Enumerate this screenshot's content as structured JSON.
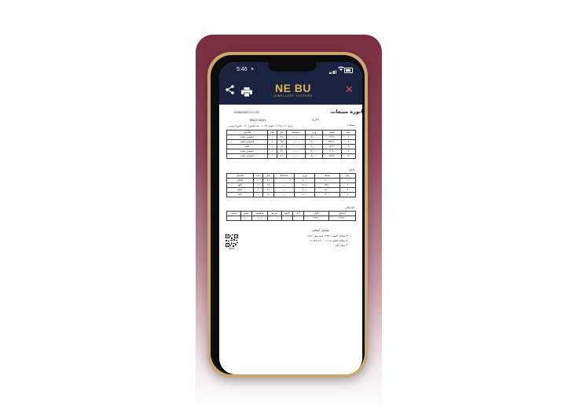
{
  "status_bar": {
    "time": "5:46",
    "location_glyph": "➤"
  },
  "app_bar": {
    "logo": "NE BU",
    "logo_subtitle": "JEWELLERY SYSTEMS",
    "share_icon": "share-icon",
    "print_icon": "printer-icon",
    "close_icon": "close-icon",
    "close_color": "#e04b4b",
    "bar_color": "#1a2440",
    "logo_color": "#e1b54a"
  },
  "invoice": {
    "title": "فاتورة مبيعات",
    "number": "1438A0S82111178",
    "tax_number": "3861278445",
    "label_right": "مبيعات",
    "label_date": "التاريخ",
    "info_line": "تاريخ: ٢٠٢٢/١١/٠٩ - الوقت ١٠:٢٥ - رقم الفاتورة ٣٧٠ - الفرع الرئيسي",
    "sales_table": {
      "headers": [
        "رقم",
        "قيمة",
        "وزن",
        "مصنعية",
        "عيار",
        "عدد",
        "تفاصيل"
      ],
      "rows": [
        [
          "١",
          "١١٩٦٠",
          "٥٫٠٠٠",
          "٠٫٠٠٠",
          "٢١",
          "١",
          "أنسيابي ذهب"
        ],
        [
          "٢",
          "٣٧٩٤٠",
          "٩٫٠٠٠",
          "٠٫٠٠٠",
          "١٨",
          "١",
          "أنسيابي ذهب"
        ],
        [
          "٣",
          "١٤٣٦٠",
          "٦٫٠٠٠",
          "٠٫٠٠٠",
          "٢٤",
          "١",
          "خاتم"
        ],
        [
          "٤",
          "٩٠٩٠",
          "٤٫٠٠٠",
          "٠٫٠٠٠",
          "٢١",
          "١",
          "أنسيابي ذهب"
        ],
        [
          "٥",
          "١٤٩٥٠",
          "٥٫٠٠٠",
          "٠٫٠٠٠",
          "٢١",
          "١",
          "أنسيابي ذهب"
        ]
      ]
    },
    "returns_label": "أعاده",
    "returns_table": {
      "headers": [
        "رقم",
        "قيمة",
        "وزن",
        "مصنعية",
        "عيار",
        "عدد",
        "تفاصيل"
      ],
      "rows": [
        [
          "١",
          "٧٠٠٠",
          "٥٫٠٠",
          "٠٫٠٠",
          "٢١",
          "١",
          "خلخال"
        ],
        [
          "٢",
          "٧٥٦٠",
          "٥٫٦٠",
          "٠٫٠٠",
          "١٨",
          "١",
          "حلق"
        ],
        [
          "٣",
          "١٨٠٠٠",
          "٩٫٠٠",
          "٠٫٠٠",
          "٢١",
          "١",
          "سلة"
        ],
        [
          "٤",
          "١٢٠٠٠",
          "٥٫٠٠",
          "٠٫٠٠",
          "١٨",
          "١",
          "دبلة"
        ]
      ]
    },
    "totals_label": "الإجمالي",
    "totals_table": {
      "headers": [
        "إجمالي",
        "كاش",
        "آجل",
        "الدفع",
        "ضريبة",
        "مدفوعة",
        "خصم",
        "حساب"
      ],
      "values": [
        "٢٦٦٦٠",
        "٢٦٦٦٠",
        "",
        "٠",
        "",
        "(٠)",
        "(٠)",
        "٠"
      ]
    },
    "notes_title": "تفاصيل اضافية",
    "notes": [
      "• سبائك الذهب ١٢٥٦٠ جنيه سعر ١٢٤١",
      "• سبائك الذهب ١٠٠٤ - ٢٠٢٤/١١/١٠",
      "• شكرا لكم"
    ],
    "qr_icon": "qr-code-icon",
    "qr_caption": "NEBU"
  }
}
